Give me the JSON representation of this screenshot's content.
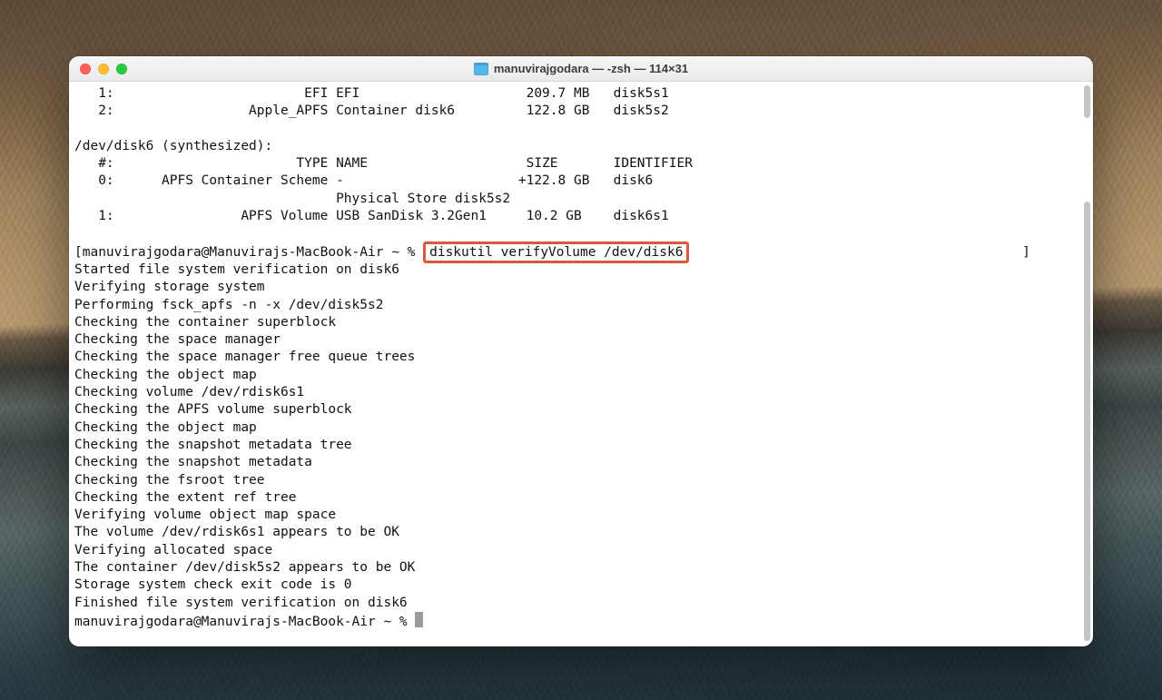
{
  "window": {
    "title": "manuvirajgodara — -zsh — 114×31"
  },
  "terminal": {
    "pre_lines": [
      "   1:                        EFI EFI                     209.7 MB   disk5s1",
      "   2:                 Apple_APFS Container disk6         122.8 GB   disk5s2",
      "",
      "/dev/disk6 (synthesized):",
      "   #:                       TYPE NAME                    SIZE       IDENTIFIER",
      "   0:      APFS Container Scheme -                      +122.8 GB   disk6",
      "                                 Physical Store disk5s2",
      "   1:                APFS Volume USB SanDisk 3.2Gen1     10.2 GB    disk6s1",
      ""
    ],
    "prompt1_prefix": "[manuvirajgodara@Manuvirajs-MacBook-Air ~ % ",
    "command": "diskutil verifyVolume /dev/disk6",
    "prompt1_suffix": "                                          ]",
    "post_lines": [
      "Started file system verification on disk6",
      "Verifying storage system",
      "Performing fsck_apfs -n -x /dev/disk5s2",
      "Checking the container superblock",
      "Checking the space manager",
      "Checking the space manager free queue trees",
      "Checking the object map",
      "Checking volume /dev/rdisk6s1",
      "Checking the APFS volume superblock",
      "Checking the object map",
      "Checking the snapshot metadata tree",
      "Checking the snapshot metadata",
      "Checking the fsroot tree",
      "Checking the extent ref tree",
      "Verifying volume object map space",
      "The volume /dev/rdisk6s1 appears to be OK",
      "Verifying allocated space",
      "The container /dev/disk5s2 appears to be OK",
      "Storage system check exit code is 0",
      "Finished file system verification on disk6"
    ],
    "prompt2": "manuvirajgodara@Manuvirajs-MacBook-Air ~ % "
  }
}
